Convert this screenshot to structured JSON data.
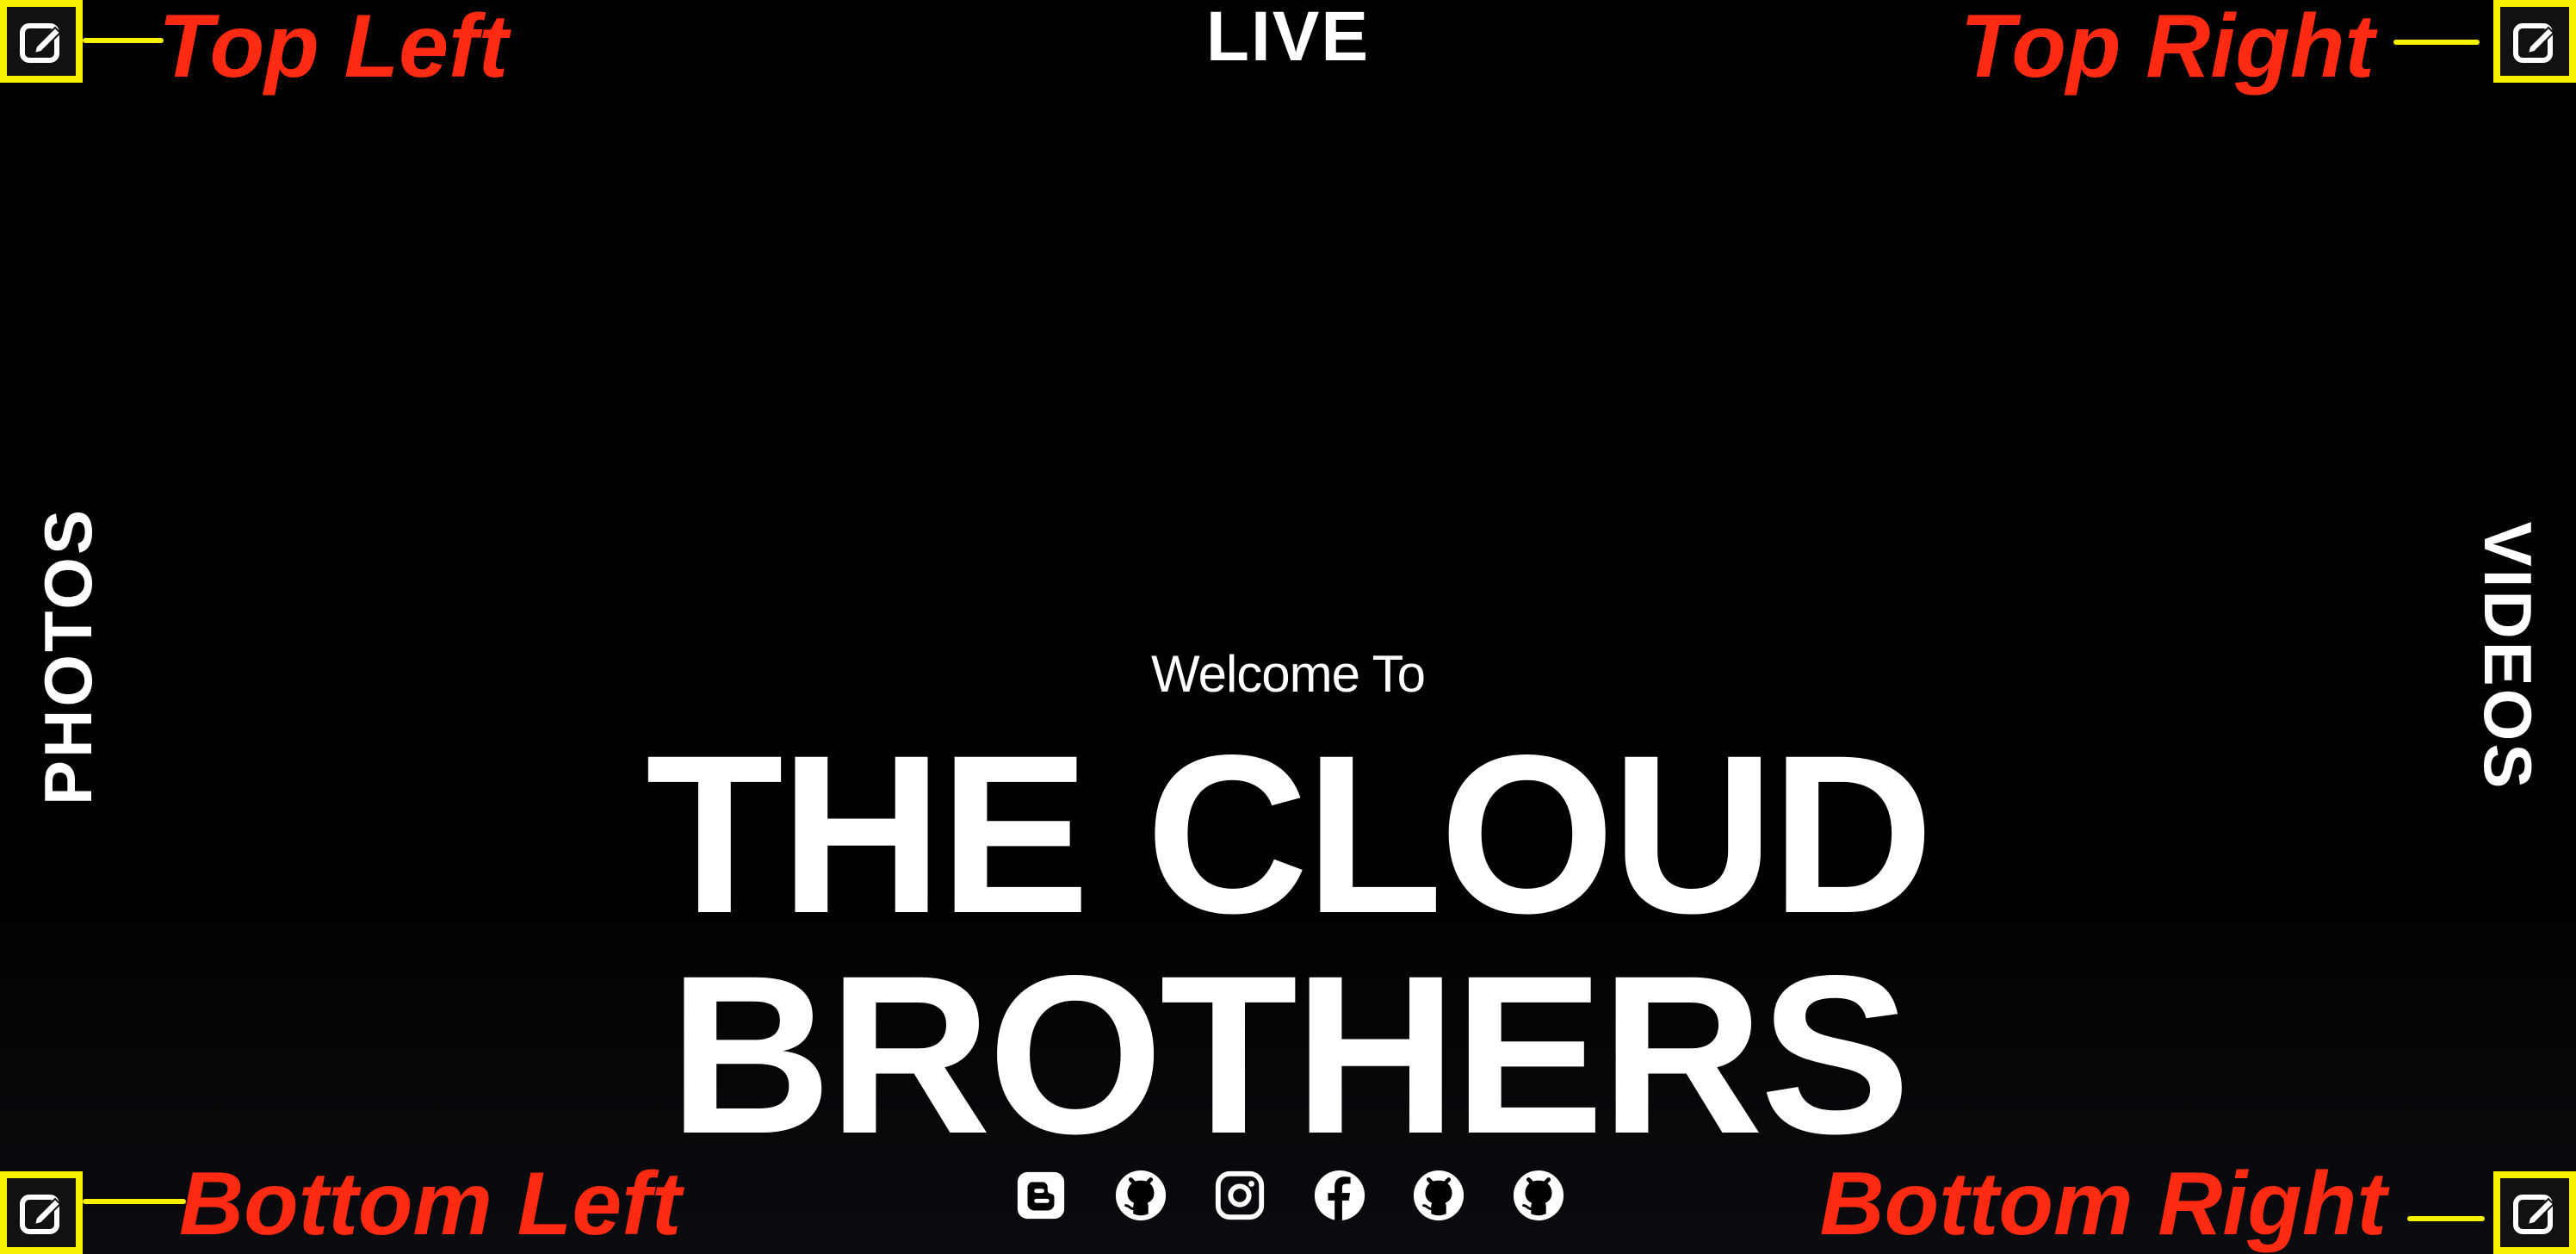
{
  "nav": {
    "live": "LIVE",
    "photos": "PHOTOS",
    "videos": "VIDEOS"
  },
  "hero": {
    "welcome": "Welcome To",
    "title_line1": "THE CLOUD",
    "title_line2": "BROTHERS"
  },
  "annotations": {
    "top_left": "Top Left",
    "top_right": "Top Right",
    "bottom_left": "Bottom Left",
    "bottom_right": "Bottom Right"
  },
  "edit_buttons": [
    {
      "icon": "edit-icon",
      "position": "top-left"
    },
    {
      "icon": "edit-icon",
      "position": "top-right"
    },
    {
      "icon": "edit-icon",
      "position": "bottom-left"
    },
    {
      "icon": "edit-icon",
      "position": "bottom-right"
    }
  ],
  "social_links": [
    {
      "icon": "blogger-icon"
    },
    {
      "icon": "github-icon"
    },
    {
      "icon": "instagram-icon"
    },
    {
      "icon": "facebook-icon"
    },
    {
      "icon": "github-icon"
    },
    {
      "icon": "github-icon"
    }
  ],
  "colors": {
    "background": "#000000",
    "text": "#ffffff",
    "annotation": "#ff2a12",
    "highlight": "#f7f000"
  }
}
